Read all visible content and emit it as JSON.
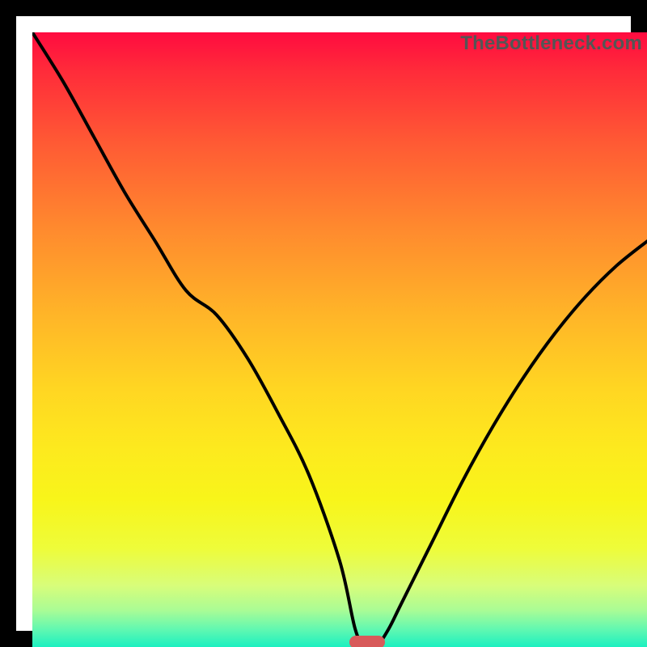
{
  "watermark": "TheBottleneck.com",
  "chart_data": {
    "type": "line",
    "title": "",
    "xlabel": "",
    "ylabel": "",
    "x": [
      0.0,
      0.05,
      0.1,
      0.15,
      0.2,
      0.25,
      0.3,
      0.35,
      0.4,
      0.45,
      0.5,
      0.525,
      0.54,
      0.55,
      0.56,
      0.58,
      0.6,
      0.65,
      0.7,
      0.75,
      0.8,
      0.85,
      0.9,
      0.95,
      1.0
    ],
    "values": [
      1.0,
      0.92,
      0.83,
      0.74,
      0.66,
      0.58,
      0.54,
      0.47,
      0.38,
      0.28,
      0.14,
      0.03,
      0.0,
      0.0,
      0.0,
      0.03,
      0.07,
      0.17,
      0.27,
      0.36,
      0.44,
      0.51,
      0.57,
      0.62,
      0.66
    ],
    "xlim": [
      0,
      1
    ],
    "ylim": [
      0,
      1
    ],
    "marker": {
      "x": 0.545,
      "y": 0.0
    },
    "annotations": []
  },
  "colors": {
    "frame": "#000000",
    "curve": "#000000",
    "marker": "#d85a5a",
    "watermark": "#555555"
  }
}
